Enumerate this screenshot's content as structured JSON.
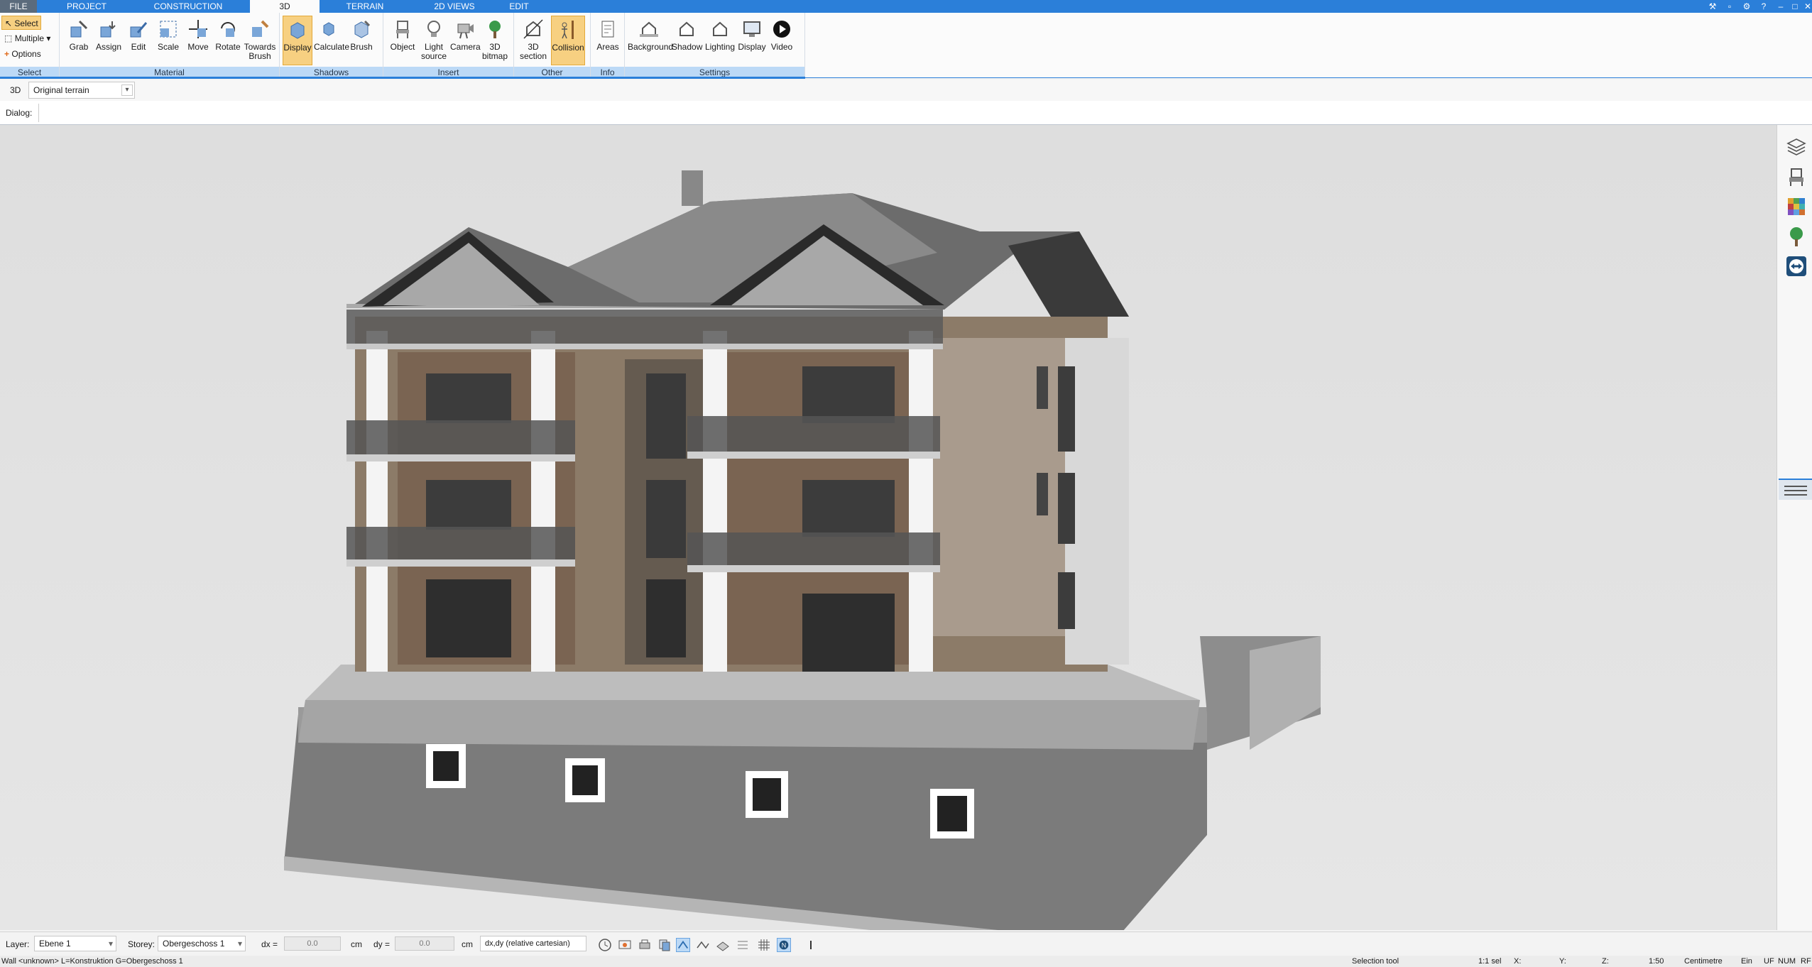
{
  "tabs": [
    "FILE",
    "PROJECT",
    "CONSTRUCTION",
    "3D",
    "TERRAIN",
    "2D VIEWS",
    "EDIT"
  ],
  "active_tab": "3D",
  "select_group": {
    "select_label": "Select",
    "multiple_label": "Multiple",
    "options_label": "Options",
    "group_label": "Select"
  },
  "ribbon": {
    "material": {
      "label": "Material",
      "buttons": [
        "Grab",
        "Assign",
        "Edit",
        "Scale",
        "Move",
        "Rotate",
        "Towards Brush"
      ]
    },
    "shadows": {
      "label": "Shadows",
      "buttons": [
        "Display",
        "Calculate",
        "Brush"
      ]
    },
    "insert": {
      "label": "Insert",
      "buttons": [
        "Object",
        "Light source",
        "Camera",
        "3D bitmap"
      ]
    },
    "other": {
      "label": "Other",
      "buttons": [
        "3D section",
        "Collision"
      ]
    },
    "info": {
      "label": "Info",
      "buttons": [
        "Areas"
      ]
    },
    "settings": {
      "label": "Settings",
      "buttons": [
        "Background",
        "Shadow",
        "Lighting",
        "Display",
        "Video"
      ]
    }
  },
  "view": {
    "label": "3D",
    "terrain_value": "Original terrain"
  },
  "dialog": {
    "label": "Dialog:"
  },
  "options_bar": {
    "layer_label": "Layer:",
    "layer_value": "Ebene 1",
    "storey_label": "Storey:",
    "storey_value": "Obergeschoss 1",
    "dx_label": "dx =",
    "dx_value": "0.0",
    "dx_unit": "cm",
    "dy_label": "dy =",
    "dy_value": "0.0",
    "dy_unit": "cm",
    "mode_value": "dx,dy (relative cartesian)"
  },
  "status": {
    "left": "Wall <unknown> L=Konstruktion G=Obergeschoss 1",
    "tool": "Selection tool",
    "sel": "1:1 sel",
    "x": "X:",
    "y": "Y:",
    "z": "Z:",
    "scale": "1:50",
    "unit": "Centimetre",
    "ein": "Ein",
    "uf": "UF",
    "num": "NUM",
    "rf": "RF"
  },
  "colors": {
    "accent": "#2b7fd9",
    "active": "#f7d081",
    "group_label_bg": "#bcd9f6"
  }
}
